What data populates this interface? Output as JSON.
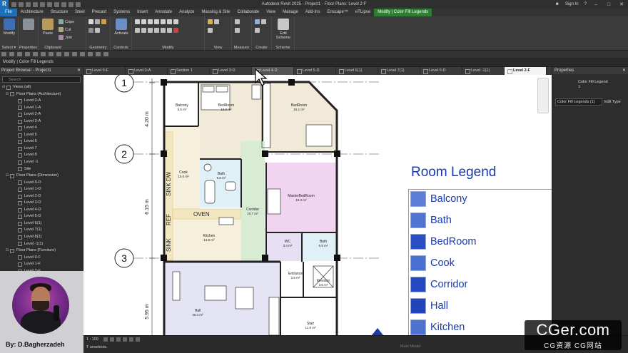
{
  "app": {
    "title": "Autodesk Revit 2025 - Project1 - Floor Plans: Level 2-F",
    "sign_in": "Sign In",
    "logo": "R"
  },
  "ribbon_tabs": [
    {
      "label": "File",
      "kind": "file"
    },
    {
      "label": "Architecture"
    },
    {
      "label": "Structure"
    },
    {
      "label": "Steel"
    },
    {
      "label": "Precast"
    },
    {
      "label": "Systems"
    },
    {
      "label": "Insert"
    },
    {
      "label": "Annotate"
    },
    {
      "label": "Analyze"
    },
    {
      "label": "Massing & Site"
    },
    {
      "label": "Collaborate"
    },
    {
      "label": "View"
    },
    {
      "label": "Manage"
    },
    {
      "label": "Add-Ins"
    },
    {
      "label": "Enscape™"
    },
    {
      "label": "eTLipse"
    },
    {
      "label": "Modify | Color Fill Legends",
      "kind": "context"
    }
  ],
  "ribbon": {
    "modify_label": "Modify",
    "select_label": "Select ▾",
    "properties_label": "Properties",
    "clipboard_label": "Clipboard",
    "paste_label": "Paste",
    "cope_label": "Cope",
    "cut_label": "Cut",
    "join_label": "Join",
    "geometry_label": "Geometry",
    "activate_label": "Activate",
    "controls_label": "Controls",
    "modify_group_label": "Modify",
    "view_label": "View",
    "measure_label": "Measure",
    "create_label": "Create",
    "edit_scheme_label": "Edit Scheme",
    "scheme_label": "Scheme"
  },
  "context_bar": "Modify | Color Fill Legends",
  "project_browser": {
    "title": "Project Browser - Project1",
    "search_placeholder": "Search",
    "items": [
      {
        "label": "Views (all)",
        "level": 0,
        "tw": "⊟"
      },
      {
        "label": "Floor Plans (Architecture)",
        "level": 1,
        "tw": "⊟"
      },
      {
        "label": "Level 0-A",
        "level": 2
      },
      {
        "label": "Level 1-A",
        "level": 2
      },
      {
        "label": "Level 2-A",
        "level": 2
      },
      {
        "label": "Level 3-A",
        "level": 2
      },
      {
        "label": "Level 4",
        "level": 2
      },
      {
        "label": "Level 5",
        "level": 2
      },
      {
        "label": "Level 6",
        "level": 2
      },
      {
        "label": "Level 7",
        "level": 2
      },
      {
        "label": "Level 8",
        "level": 2
      },
      {
        "label": "Level -1",
        "level": 2
      },
      {
        "label": "Site",
        "level": 2
      },
      {
        "label": "Floor Plans (Dimension)",
        "level": 1,
        "tw": "⊟"
      },
      {
        "label": "Level 0-D",
        "level": 2
      },
      {
        "label": "Level 1-D",
        "level": 2
      },
      {
        "label": "Level 2-D",
        "level": 2
      },
      {
        "label": "Level 3-D",
        "level": 2
      },
      {
        "label": "Level 4-D",
        "level": 2
      },
      {
        "label": "Level 5-D",
        "level": 2
      },
      {
        "label": "Level 6(1)",
        "level": 2
      },
      {
        "label": "Level 7(1)",
        "level": 2
      },
      {
        "label": "Level 8(1)",
        "level": 2
      },
      {
        "label": "Level -1(1)",
        "level": 2
      },
      {
        "label": "Floor Plans (Furniture)",
        "level": 1,
        "tw": "⊟"
      },
      {
        "label": "Level 0-F",
        "level": 2
      },
      {
        "label": "Level 1-F",
        "level": 2
      },
      {
        "label": "Level 2-F",
        "level": 2
      }
    ]
  },
  "presenter": {
    "byline": "By: D.Bagherzadeh"
  },
  "view_tabs": [
    {
      "label": "Level 0-F"
    },
    {
      "label": "Level 0-A"
    },
    {
      "label": "Section 1"
    },
    {
      "label": "Level 3-D"
    },
    {
      "label": "Level 4-D",
      "state": "hover"
    },
    {
      "label": "Level 5-D"
    },
    {
      "label": "Level 6(1)"
    },
    {
      "label": "Level 7(1)"
    },
    {
      "label": "Level 0-D"
    },
    {
      "label": "Level -1(1)"
    },
    {
      "label": "Level 2-F",
      "state": "active"
    }
  ],
  "plan": {
    "grid_bubbles": [
      "1",
      "2",
      "3"
    ],
    "dimensions": [
      "4.20 m",
      "6.15 m",
      "5.95 m"
    ],
    "rooms": [
      {
        "name": "Balcony",
        "area": "5.5 m²"
      },
      {
        "name": "BedRoom",
        "area": "16.0 m²"
      },
      {
        "name": "BedRoom",
        "area": "16.1 m²"
      },
      {
        "name": "Cook",
        "area": "10.0 m²"
      },
      {
        "name": "Bath",
        "area": "5.8 m²"
      },
      {
        "name": "MasterBedRoom",
        "area": "19.3 m²"
      },
      {
        "name": "Corridor",
        "area": "10.7 m²"
      },
      {
        "name": "Kitchen",
        "area": "13.9 m²"
      },
      {
        "name": "WC",
        "area": "3.4 m²"
      },
      {
        "name": "Bath",
        "area": "5.5 m²"
      },
      {
        "name": "Entrance",
        "area": "2.5 m²"
      },
      {
        "name": "Elevator",
        "area": "3.5 m²"
      },
      {
        "name": "Hall",
        "area": "40.4 m²"
      },
      {
        "name": "Stair",
        "area": "11.9 m²"
      }
    ],
    "vertical_labels": [
      "SINK DW",
      "REF",
      "SINK",
      "OVEN"
    ]
  },
  "legend": {
    "title": "Room Legend",
    "items": [
      {
        "label": "Balcony",
        "color": "#5b7fd6"
      },
      {
        "label": "Bath",
        "color": "#4f74d2"
      },
      {
        "label": "BedRoom",
        "color": "#2a4fc4"
      },
      {
        "label": "Cook",
        "color": "#4a70d0"
      },
      {
        "label": "Corridor",
        "color": "#2549bf"
      },
      {
        "label": "Hall",
        "color": "#2244bb"
      },
      {
        "label": "Kitchen",
        "color": "#4d72d1"
      }
    ]
  },
  "properties": {
    "title": "Properties",
    "type_line1": "Color Fill Legend",
    "type_line2": "1",
    "selector": "Color Fill Legends (1)",
    "edit_type": "Edit Type"
  },
  "status": {
    "scale": "1 : 100",
    "unselects": "T unselects.",
    "main_model": "Main Model"
  },
  "watermark": {
    "main": "CGer.com",
    "sub": "CG资源 CG网站"
  },
  "colors": {
    "file_tab": "#1f6fb8",
    "context_tab": "#2d7d32",
    "legend_text": "#1a3aa8",
    "bedroom_fill": "#f1ead8",
    "corridor_fill": "#d7ecd2",
    "master_fill": "#f1d4ef",
    "hall_fill": "#e3e3f4",
    "bath_fill": "#dff0f6",
    "kitchen_fill": "#f5efdc"
  }
}
